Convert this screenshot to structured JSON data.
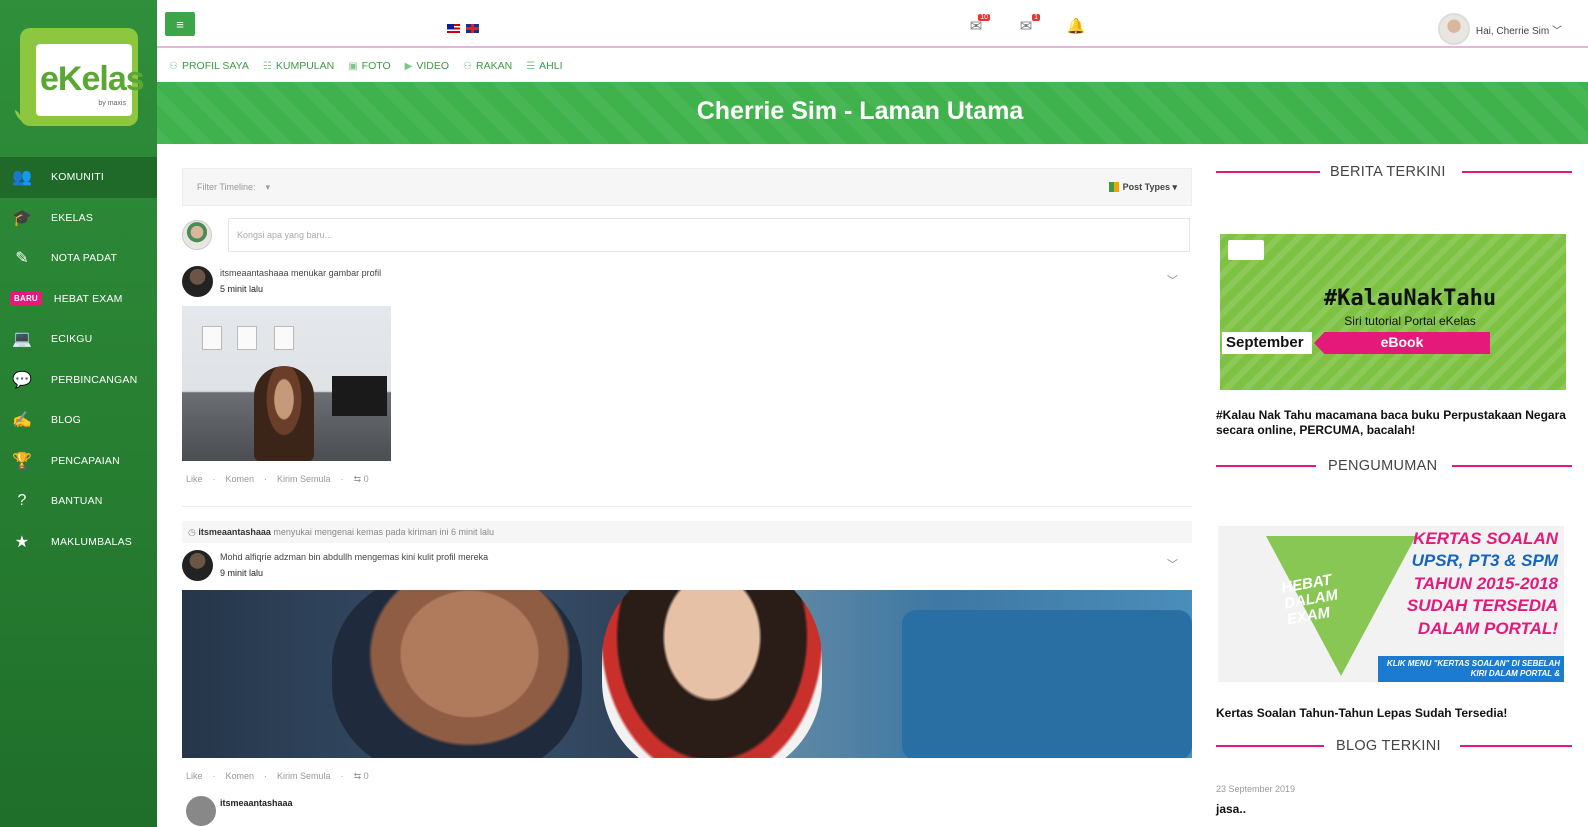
{
  "brand": {
    "logo_text": "eKelas",
    "logo_sub": "by maxis"
  },
  "sidebar": {
    "items": [
      {
        "label": "KOMUNITI",
        "icon": "community-icon",
        "glyph": "👥",
        "active": true
      },
      {
        "label": "EKELAS",
        "icon": "graduation-cap-icon",
        "glyph": "🎓"
      },
      {
        "label": "NOTA PADAT",
        "icon": "notebook-icon",
        "glyph": "✎"
      },
      {
        "label": "HEBAT EXAM",
        "icon": "",
        "glyph": "",
        "badge": "baru"
      },
      {
        "label": "ECIKGU",
        "icon": "laptop-icon",
        "glyph": "💻"
      },
      {
        "label": "PERBINCANGAN",
        "icon": "chat-icon",
        "glyph": "💬"
      },
      {
        "label": "BLOG",
        "icon": "edit-icon",
        "glyph": "✍"
      },
      {
        "label": "PENCAPAIAN",
        "icon": "trophy-icon",
        "glyph": "🏆"
      },
      {
        "label": "BANTUAN",
        "icon": "help-icon",
        "glyph": "?"
      },
      {
        "label": "MAKLUMBALAS",
        "icon": "feedback-icon",
        "glyph": "★"
      }
    ]
  },
  "topbar": {
    "menu_glyph": "≡",
    "greeting": "Hai, Cherrie Sim ﹀",
    "icons": [
      {
        "name": "messages-icon",
        "glyph": "✉",
        "count": "10"
      },
      {
        "name": "mail-icon",
        "glyph": "✉",
        "count": "1"
      },
      {
        "name": "bell-icon",
        "glyph": "🔔",
        "count": ""
      }
    ]
  },
  "submenu": {
    "items": [
      {
        "label": "PROFIL SAYA",
        "glyph": "⚇"
      },
      {
        "label": "KUMPULAN",
        "glyph": "☷"
      },
      {
        "label": "FOTO",
        "glyph": "▣"
      },
      {
        "label": "VIDEO",
        "glyph": "▶"
      },
      {
        "label": "RAKAN",
        "glyph": "⚇"
      },
      {
        "label": "AHLI",
        "glyph": "☰"
      }
    ]
  },
  "banner": {
    "title": "Cherrie Sim - Laman Utama"
  },
  "feed": {
    "filter_label": "Filter Timeline:",
    "filter_caret": "▾",
    "post_types": "Post Types ▾",
    "compose_placeholder": "Kongsi apa yang baru...",
    "post1": {
      "text": "itsmeaantashaaa menukar gambar profil",
      "time": "5 minit lalu",
      "caret": "﹀",
      "actions": [
        "Like",
        "·",
        "Komen",
        "·",
        "Kirim Semula",
        "·",
        "⇆ 0"
      ]
    },
    "activity": {
      "user": "itsmeaantashaaa",
      "text": " menyukai mengenai kemas pada kiriman ini 6 minit lalu"
    },
    "post2": {
      "text": "Mohd alfiqrie adzman bin abdullh mengemas kini kulit profil mereka",
      "time": "9 minit lalu",
      "caret": "﹀",
      "actions": [
        "Like",
        "·",
        "Komen",
        "·",
        "Kirim Semula",
        "·",
        "⇆ 0"
      ]
    },
    "post3": {
      "user": "itsmeaantashaaa"
    }
  },
  "right": {
    "sections": {
      "berita": "BERITA TERKINI",
      "pengumuman": "PENGUMUMAN",
      "blog": "BLOG TERKINI"
    },
    "ad1": {
      "tag": "#KalauNakTahu",
      "sub": "Siri tutorial Portal eKelas",
      "month": "September",
      "cta": "eBook"
    },
    "news_caption": "#Kalau Nak Tahu macamana baca buku Perpustakaan Negara secara online, PERCUMA, bacalah!",
    "ad2": {
      "hebat": "HEBAT\nDALAM\nEXAM",
      "l1": "KERTAS SOALAN",
      "l2": "UPSR, PT3 & SPM",
      "l3": "TAHUN 2015-2018",
      "l4": "SUDAH TERSEDIA",
      "l5": "DALAM PORTAL!",
      "foot": "KLIK MENU \"KERTAS SOALAN\" DI SEBELAH KIRI DALAM PORTAL &"
    },
    "exam_caption": "Kertas Soalan Tahun-Tahun Lepas Sudah Tersedia!",
    "blog_date": "23 September 2019",
    "blog_title": "jasa.."
  },
  "colors": {
    "primary_green": "#3fb24c",
    "accent_pink": "#e5197a",
    "sidebar_green": "#2f8f3a"
  }
}
